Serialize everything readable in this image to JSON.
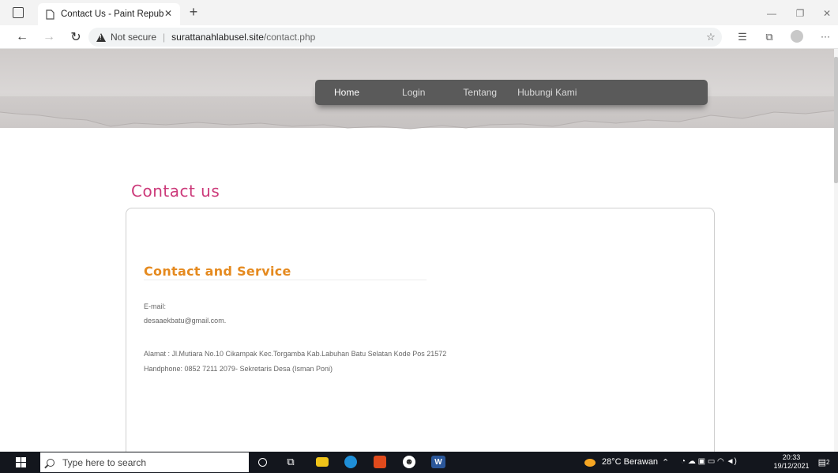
{
  "browser": {
    "tab_title": "Contact Us - Paint Republic Web",
    "tab_close": "✕",
    "new_tab": "+",
    "security_label": "Not secure",
    "url_host": "surattanahlabusel.site",
    "url_path": "/contact.php",
    "window_controls": {
      "minimize": "—",
      "restore": "❐",
      "close": "✕"
    },
    "more_label": "···"
  },
  "nav": {
    "items": [
      "Home",
      "Login",
      "Tentang",
      "Hubungi Kami"
    ],
    "active": "Home"
  },
  "page": {
    "title": "Contact us",
    "section_title": "Contact and Service",
    "email_label": "E-mail:",
    "email_value": "desaaekbatu@gmail.com.",
    "address": "Alamat : Jl.Mutiara No.10 Cikampak Kec.Torgamba Kab.Labuhan Batu Selatan Kode Pos 21572",
    "handphone": "Handphone: 0852 7211 2079- Sekretaris Desa (Isman Poni)"
  },
  "taskbar": {
    "search_placeholder": "Type here to search",
    "weather": "28°C  Berawan",
    "time": "20:33",
    "date": "19/12/2021",
    "notification_count": "2"
  },
  "colors": {
    "title_pink": "#cc3a7a",
    "section_orange": "#e58a1f",
    "nav_bg": "#5a5a5a"
  }
}
